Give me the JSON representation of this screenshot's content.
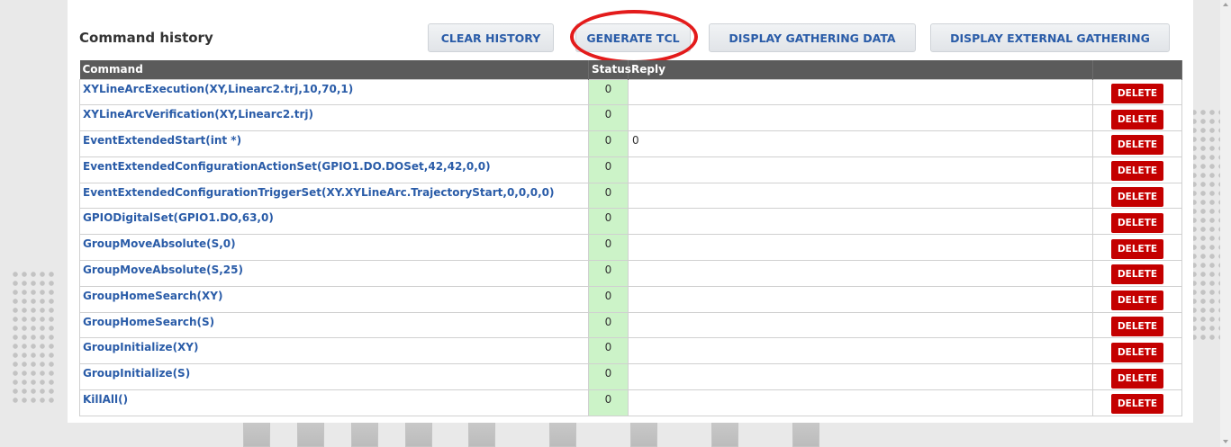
{
  "panel": {
    "title": "Command history",
    "buttons": {
      "clear_history": "CLEAR HISTORY",
      "generate_tcl": "GENERATE TCL",
      "display_gathering_data": "DISPLAY GATHERING DATA",
      "display_external_gathering": "DISPLAY EXTERNAL GATHERING"
    }
  },
  "table": {
    "headers": {
      "command": "Command",
      "status": "Status",
      "reply": "Reply",
      "action": ""
    },
    "rows": [
      {
        "command": "XYLineArcExecution(XY,Linearc2.trj,10,70,1)",
        "status": "0",
        "reply": "",
        "action": "DELETE"
      },
      {
        "command": "XYLineArcVerification(XY,Linearc2.trj)",
        "status": "0",
        "reply": "",
        "action": "DELETE"
      },
      {
        "command": "EventExtendedStart(int *)",
        "status": "0",
        "reply": "0",
        "action": "DELETE"
      },
      {
        "command": "EventExtendedConfigurationActionSet(GPIO1.DO.DOSet,42,42,0,0)",
        "status": "0",
        "reply": "",
        "action": "DELETE"
      },
      {
        "command": "EventExtendedConfigurationTriggerSet(XY.XYLineArc.TrajectoryStart,0,0,0,0)",
        "status": "0",
        "reply": "",
        "action": "DELETE"
      },
      {
        "command": "GPIODigitalSet(GPIO1.DO,63,0)",
        "status": "0",
        "reply": "",
        "action": "DELETE"
      },
      {
        "command": "GroupMoveAbsolute(S,0)",
        "status": "0",
        "reply": "",
        "action": "DELETE"
      },
      {
        "command": "GroupMoveAbsolute(S,25)",
        "status": "0",
        "reply": "",
        "action": "DELETE"
      },
      {
        "command": "GroupHomeSearch(XY)",
        "status": "0",
        "reply": "",
        "action": "DELETE"
      },
      {
        "command": "GroupHomeSearch(S)",
        "status": "0",
        "reply": "",
        "action": "DELETE"
      },
      {
        "command": "GroupInitialize(XY)",
        "status": "0",
        "reply": "",
        "action": "DELETE"
      },
      {
        "command": "GroupInitialize(S)",
        "status": "0",
        "reply": "",
        "action": "DELETE"
      },
      {
        "command": "KillAll()",
        "status": "0",
        "reply": "",
        "action": "DELETE"
      }
    ]
  },
  "colors": {
    "link_blue": "#2a5ca8",
    "header_gray": "#5b5b5b",
    "status_green": "#ccf3c8",
    "delete_red": "#c40000",
    "highlight_red": "#e31b1b"
  }
}
